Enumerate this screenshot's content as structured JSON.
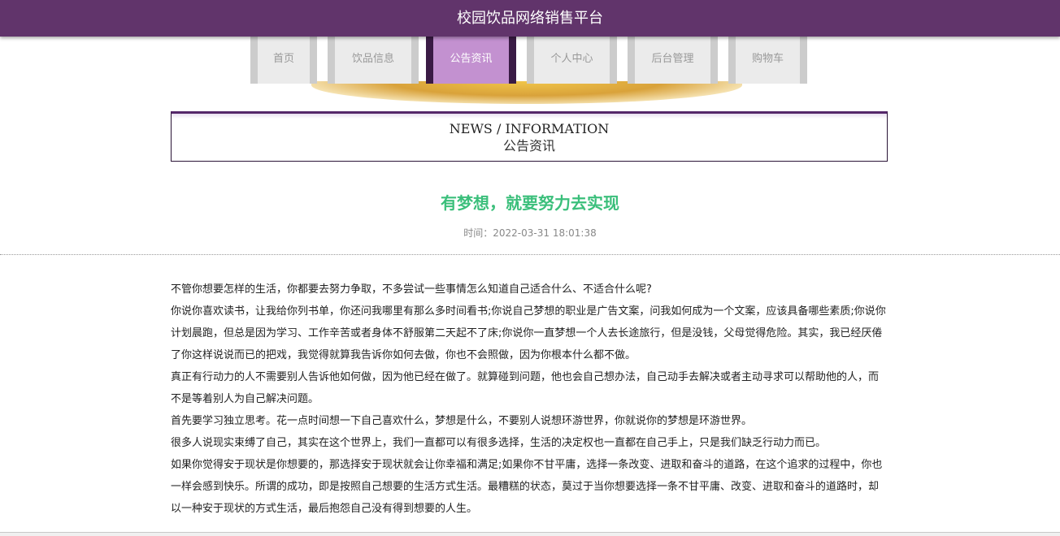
{
  "header": {
    "title": "校园饮品网络销售平台"
  },
  "nav": [
    {
      "label": "首页",
      "active": false
    },
    {
      "label": "饮品信息",
      "active": false
    },
    {
      "label": "公告资讯",
      "active": true
    },
    {
      "label": "个人中心",
      "active": false
    },
    {
      "label": "后台管理",
      "active": false
    },
    {
      "label": "购物车",
      "active": false
    }
  ],
  "section": {
    "title_en": "NEWS / INFORMATION",
    "title_cn": "公告资讯"
  },
  "article": {
    "title": "有梦想，就要努力去实现",
    "time": "时间：2022-03-31 18:01:38",
    "paragraphs": [
      "不管你想要怎样的生活，你都要去努力争取，不多尝试一些事情怎么知道自己适合什么、不适合什么呢?",
      "你说你喜欢读书，让我给你列书单，你还问我哪里有那么多时间看书;你说自己梦想的职业是广告文案，问我如何成为一个文案，应该具备哪些素质;你说你计划晨跑，但总是因为学习、工作辛苦或者身体不舒服第二天起不了床;你说你一直梦想一个人去长途旅行，但是没钱，父母觉得危险。其实，我已经厌倦了你这样说说而已的把戏，我觉得就算我告诉你如何去做，你也不会照做，因为你根本什么都不做。",
      "真正有行动力的人不需要别人告诉他如何做，因为他已经在做了。就算碰到问题，他也会自己想办法，自己动手去解决或者主动寻求可以帮助他的人，而不是等着别人为自己解决问题。",
      "首先要学习独立思考。花一点时间想一下自己喜欢什么，梦想是什么，不要别人说想环游世界，你就说你的梦想是环游世界。",
      "很多人说现实束缚了自己，其实在这个世界上，我们一直都可以有很多选择，生活的决定权也一直都在自己手上，只是我们缺乏行动力而已。",
      "如果你觉得安于现状是你想要的，那选择安于现状就会让你幸福和满足;如果你不甘平庸，选择一条改变、进取和奋斗的道路，在这个追求的过程中，你也一样会感到快乐。所谓的成功，即是按照自己想要的生活方式生活。最糟糕的状态，莫过于当你想要选择一条不甘平庸、改变、进取和奋斗的道路时，却以一种安于现状的方式生活，最后抱怨自己没有得到想要的人生。"
    ]
  }
}
